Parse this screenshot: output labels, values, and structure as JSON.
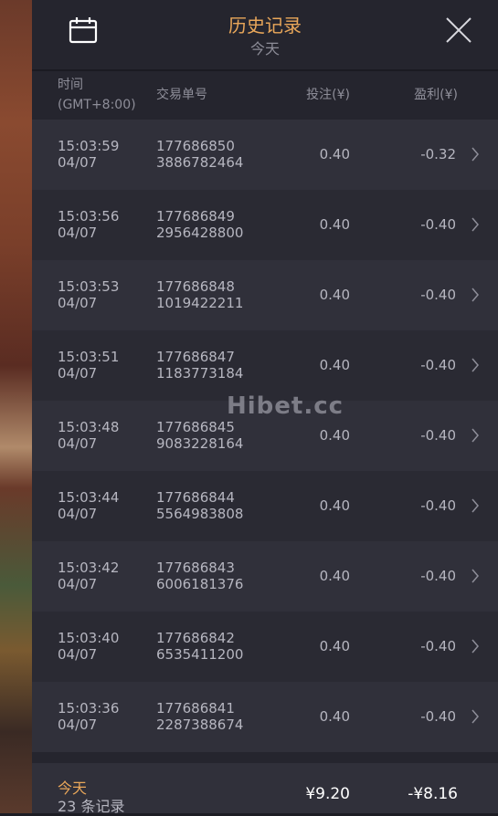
{
  "header": {
    "title": "历史记录",
    "subtitle": "今天",
    "calendar_icon": "calendar-icon",
    "close_icon": "close-icon"
  },
  "columns": {
    "time_line1": "时间",
    "time_line2": "(GMT+8:00)",
    "order": "交易单号",
    "bet": "投注(¥)",
    "profit": "盈利(¥)"
  },
  "rows": [
    {
      "time": "15:03:59",
      "date": "04/07",
      "order1": "177686850",
      "order2": "3886782464",
      "bet": "0.40",
      "profit": "-0.32"
    },
    {
      "time": "15:03:56",
      "date": "04/07",
      "order1": "177686849",
      "order2": "2956428800",
      "bet": "0.40",
      "profit": "-0.40"
    },
    {
      "time": "15:03:53",
      "date": "04/07",
      "order1": "177686848",
      "order2": "1019422211",
      "bet": "0.40",
      "profit": "-0.40"
    },
    {
      "time": "15:03:51",
      "date": "04/07",
      "order1": "177686847",
      "order2": "1183773184",
      "bet": "0.40",
      "profit": "-0.40"
    },
    {
      "time": "15:03:48",
      "date": "04/07",
      "order1": "177686845",
      "order2": "9083228164",
      "bet": "0.40",
      "profit": "-0.40"
    },
    {
      "time": "15:03:44",
      "date": "04/07",
      "order1": "177686844",
      "order2": "5564983808",
      "bet": "0.40",
      "profit": "-0.40"
    },
    {
      "time": "15:03:42",
      "date": "04/07",
      "order1": "177686843",
      "order2": "6006181376",
      "bet": "0.40",
      "profit": "-0.40"
    },
    {
      "time": "15:03:40",
      "date": "04/07",
      "order1": "177686842",
      "order2": "6535411200",
      "bet": "0.40",
      "profit": "-0.40"
    },
    {
      "time": "15:03:36",
      "date": "04/07",
      "order1": "177686841",
      "order2": "2287388674",
      "bet": "0.40",
      "profit": "-0.40"
    }
  ],
  "watermark": "Hibet.cc",
  "footer": {
    "today": "今天",
    "count": "23 条记录",
    "total_bet": "¥9.20",
    "total_profit": "-¥8.16"
  },
  "colors": {
    "accent": "#e9a75a",
    "panel_bg": "#25252e",
    "row_odd": "#30303a",
    "row_even": "#2a2a33"
  }
}
